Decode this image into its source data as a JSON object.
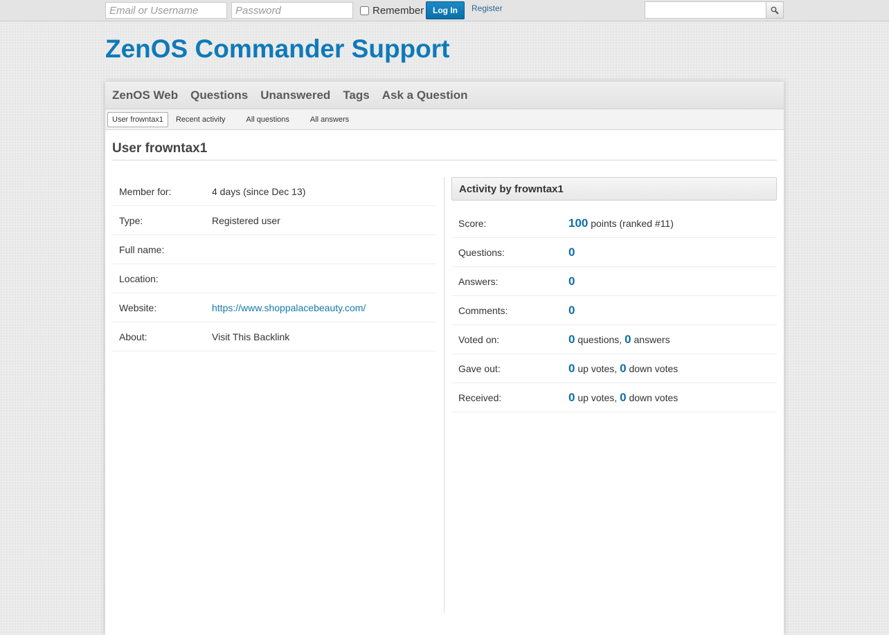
{
  "topbar": {
    "email_placeholder": "Email or Username",
    "password_placeholder": "Password",
    "remember_label": "Remember",
    "login_label": "Log In",
    "register_label": "Register",
    "search_icon": "search-icon"
  },
  "site": {
    "title": "ZenOS Commander Support"
  },
  "nav": {
    "items": [
      "ZenOS Web",
      "Questions",
      "Unanswered",
      "Tags",
      "Ask a Question"
    ]
  },
  "subnav": {
    "items": [
      "User frowntax1",
      "Recent activity",
      "All questions",
      "All answers"
    ]
  },
  "page": {
    "title": "User frowntax1"
  },
  "details": [
    {
      "label": "Member for:",
      "value": "4 days (since Dec 13)"
    },
    {
      "label": "Type:",
      "value": "Registered user"
    },
    {
      "label": "Full name:",
      "value": ""
    },
    {
      "label": "Location:",
      "value": ""
    },
    {
      "label": "Website:",
      "value": "https://www.shoppalacebeauty.com/"
    },
    {
      "label": "About:",
      "value": "Visit This Backlink"
    }
  ],
  "activity": {
    "heading": "Activity by frowntax1",
    "score": {
      "label": "Score:",
      "points": "100",
      "suffix": "points (ranked #11)"
    },
    "questions": {
      "label": "Questions:",
      "value": "0"
    },
    "answers": {
      "label": "Answers:",
      "value": "0"
    },
    "comments": {
      "label": "Comments:",
      "value": "0"
    },
    "voted_on": {
      "label": "Voted on:",
      "questions": "0",
      "questions_label": "questions,",
      "answers": "0",
      "answers_label": "answers"
    },
    "gave_out": {
      "label": "Gave out:",
      "up": "0",
      "up_label": "up votes,",
      "down": "0",
      "down_label": "down votes"
    },
    "received": {
      "label": "Received:",
      "up": "0",
      "up_label": "up votes,",
      "down": "0",
      "down_label": "down votes"
    }
  },
  "colors": {
    "accent": "#0f7ab8",
    "number": "#0f6ea6",
    "button": "#0a6ea8"
  }
}
